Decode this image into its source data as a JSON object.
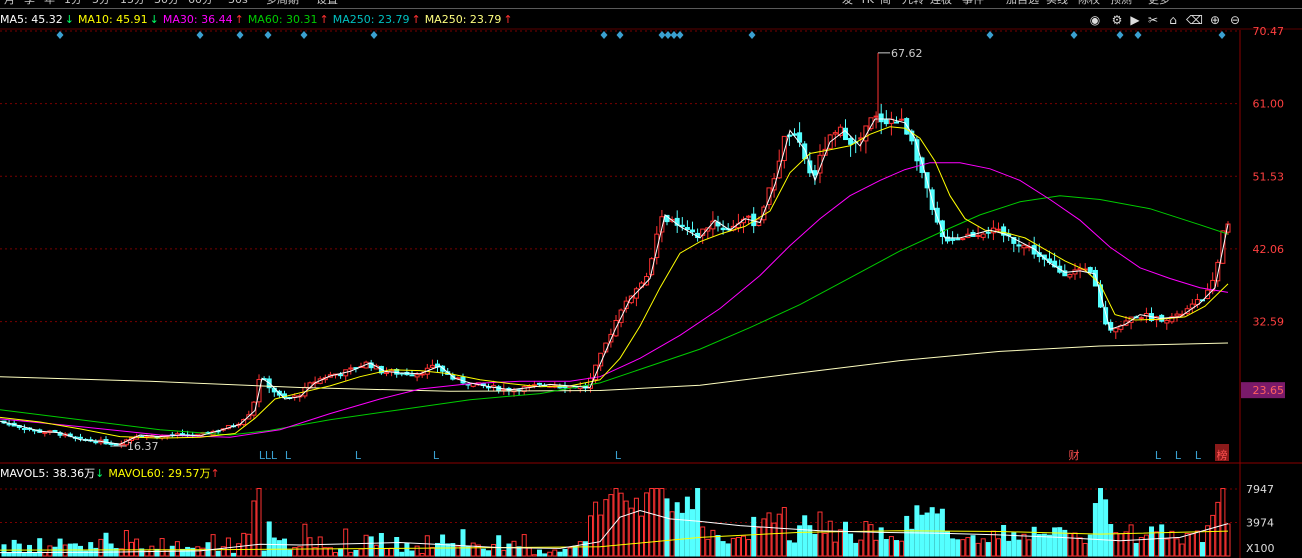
{
  "period_tabs": [
    "月",
    "季",
    "年",
    "1分",
    "5分",
    "15分",
    "30分",
    "60分",
    "30s",
    "多周期",
    "设置"
  ],
  "right_menu": [
    "发",
    "TK",
    "简",
    "九转",
    "连板",
    "事件",
    "加自选",
    "实线",
    "除权",
    "预测",
    "更多"
  ],
  "ma_legend": [
    {
      "label": "MA5: 45.32",
      "arrow": "↓",
      "color": "#ffffff"
    },
    {
      "label": "MA10: 45.91",
      "arrow": "↓",
      "color": "#ffff00"
    },
    {
      "label": "MA30: 36.44",
      "arrow": "↑",
      "color": "#ff00ff"
    },
    {
      "label": "MA60: 30.31",
      "arrow": "↑",
      "color": "#00cc00"
    },
    {
      "label": "MA250: 23.79",
      "arrow": "↑",
      "color": "#00c0c0"
    },
    {
      "label": "MA250: 23.79",
      "arrow": "↑",
      "color": "#ffff80"
    }
  ],
  "toolbar_icons": [
    "eye-icon",
    "gear-icon",
    "play-icon",
    "scissors-icon",
    "lock-icon",
    "trash-icon",
    "zoom-in-icon",
    "zoom-out-icon"
  ],
  "price_axis": [
    "70.47",
    "61.00",
    "51.53",
    "42.06",
    "32.59",
    "23.65"
  ],
  "current_price_label": "23.65",
  "high_label": "67.62",
  "low_label": "16.37",
  "volume_legend": [
    {
      "label": "MAVOL5: 38.36万",
      "arrow": "↓",
      "color": "#ffffff"
    },
    {
      "label": "MAVOL60: 29.57万",
      "arrow": "↑",
      "color": "#ffff00"
    }
  ],
  "volume_axis": [
    "7947",
    "3974"
  ],
  "volume_unit": "X100",
  "bottom_markers": [
    "L",
    "L",
    "L",
    "L",
    "L",
    "L",
    "L",
    "财",
    "L",
    "L",
    "L",
    "榜"
  ],
  "colors": {
    "up": "#ff3232",
    "down": "#54ffff",
    "ma5": "#ffffff",
    "ma10": "#ffff00",
    "ma30": "#ff00ff",
    "ma60": "#00cc00",
    "ma250": "#ffffc0",
    "grid": "#7a0000",
    "axis_text": "#ff4040",
    "marker": "#3aa0d0"
  },
  "chart_data": {
    "type": "candlestick",
    "note_price_range": [
      16.37,
      67.62
    ],
    "ylim": [
      16.37,
      70.47
    ],
    "series_names": [
      "MA5",
      "MA10",
      "MA30",
      "MA60",
      "MA250"
    ],
    "close_path": [
      [
        0,
        19.6
      ],
      [
        20,
        19.0
      ],
      [
        40,
        18.3
      ],
      [
        60,
        18.1
      ],
      [
        80,
        17.2
      ],
      [
        100,
        17.0
      ],
      [
        120,
        16.6
      ],
      [
        140,
        17.8
      ],
      [
        160,
        17.6
      ],
      [
        180,
        17.8
      ],
      [
        200,
        17.7
      ],
      [
        220,
        18.4
      ],
      [
        240,
        19.2
      ],
      [
        255,
        21.0
      ],
      [
        262,
        25.2
      ],
      [
        270,
        24.5
      ],
      [
        285,
        22.5
      ],
      [
        300,
        22.8
      ],
      [
        315,
        24.6
      ],
      [
        330,
        25.5
      ],
      [
        350,
        26.1
      ],
      [
        370,
        27.2
      ],
      [
        385,
        26.1
      ],
      [
        400,
        25.9
      ],
      [
        420,
        25.8
      ],
      [
        440,
        26.8
      ],
      [
        455,
        25.2
      ],
      [
        470,
        24.6
      ],
      [
        490,
        24.1
      ],
      [
        510,
        23.7
      ],
      [
        530,
        24.0
      ],
      [
        550,
        24.4
      ],
      [
        570,
        24.2
      ],
      [
        590,
        24.0
      ],
      [
        605,
        28.5
      ],
      [
        615,
        31.5
      ],
      [
        630,
        35.5
      ],
      [
        650,
        38.2
      ],
      [
        665,
        46.5
      ],
      [
        680,
        45.0
      ],
      [
        700,
        43.5
      ],
      [
        715,
        45.8
      ],
      [
        730,
        44.5
      ],
      [
        745,
        46.0
      ],
      [
        760,
        45.5
      ],
      [
        775,
        50.5
      ],
      [
        790,
        57.5
      ],
      [
        805,
        55.0
      ],
      [
        815,
        51.0
      ],
      [
        830,
        56.0
      ],
      [
        845,
        57.5
      ],
      [
        860,
        55.5
      ],
      [
        875,
        59.0
      ],
      [
        890,
        59.0
      ],
      [
        905,
        58.5
      ],
      [
        915,
        56.5
      ],
      [
        925,
        52.0
      ],
      [
        935,
        47.0
      ],
      [
        945,
        43.5
      ],
      [
        960,
        43.5
      ],
      [
        975,
        44.0
      ],
      [
        990,
        44.5
      ],
      [
        1005,
        44.0
      ],
      [
        1020,
        43.0
      ],
      [
        1035,
        42.0
      ],
      [
        1050,
        40.2
      ],
      [
        1065,
        39.0
      ],
      [
        1080,
        39.2
      ],
      [
        1095,
        38.8
      ],
      [
        1110,
        31.6
      ],
      [
        1125,
        32.2
      ],
      [
        1140,
        33.5
      ],
      [
        1160,
        33.0
      ],
      [
        1180,
        33.2
      ],
      [
        1200,
        35.0
      ],
      [
        1215,
        37.0
      ],
      [
        1228,
        45.3
      ]
    ],
    "ma10_path": [
      [
        0,
        20.1
      ],
      [
        40,
        19.5
      ],
      [
        80,
        18.6
      ],
      [
        120,
        17.6
      ],
      [
        160,
        17.4
      ],
      [
        200,
        17.5
      ],
      [
        235,
        18.0
      ],
      [
        255,
        20.0
      ],
      [
        275,
        22.5
      ],
      [
        300,
        23.3
      ],
      [
        330,
        24.2
      ],
      [
        360,
        25.4
      ],
      [
        390,
        26.3
      ],
      [
        420,
        26.2
      ],
      [
        450,
        25.8
      ],
      [
        480,
        25.0
      ],
      [
        510,
        24.5
      ],
      [
        540,
        24.1
      ],
      [
        570,
        24.2
      ],
      [
        600,
        25.0
      ],
      [
        620,
        27.8
      ],
      [
        640,
        32.0
      ],
      [
        660,
        37.0
      ],
      [
        680,
        41.5
      ],
      [
        700,
        43.0
      ],
      [
        720,
        44.0
      ],
      [
        745,
        45.0
      ],
      [
        770,
        47.0
      ],
      [
        790,
        52.0
      ],
      [
        810,
        54.5
      ],
      [
        830,
        55.0
      ],
      [
        850,
        55.5
      ],
      [
        870,
        57.0
      ],
      [
        890,
        58.0
      ],
      [
        905,
        57.8
      ],
      [
        920,
        56.5
      ],
      [
        935,
        53.5
      ],
      [
        950,
        49.0
      ],
      [
        965,
        46.0
      ],
      [
        985,
        44.5
      ],
      [
        1005,
        44.2
      ],
      [
        1025,
        43.5
      ],
      [
        1045,
        42.0
      ],
      [
        1065,
        40.5
      ],
      [
        1085,
        39.3
      ],
      [
        1100,
        37.5
      ],
      [
        1115,
        33.5
      ],
      [
        1135,
        32.8
      ],
      [
        1160,
        32.9
      ],
      [
        1185,
        33.2
      ],
      [
        1205,
        34.6
      ],
      [
        1228,
        37.5
      ]
    ],
    "ma30_path": [
      [
        0,
        19.9
      ],
      [
        80,
        18.9
      ],
      [
        160,
        17.8
      ],
      [
        230,
        17.5
      ],
      [
        280,
        18.5
      ],
      [
        330,
        20.6
      ],
      [
        380,
        22.5
      ],
      [
        420,
        23.8
      ],
      [
        470,
        24.5
      ],
      [
        520,
        24.8
      ],
      [
        570,
        24.8
      ],
      [
        600,
        25.4
      ],
      [
        640,
        27.8
      ],
      [
        680,
        30.8
      ],
      [
        720,
        34.3
      ],
      [
        760,
        38.6
      ],
      [
        790,
        42.5
      ],
      [
        820,
        46.0
      ],
      [
        850,
        49.0
      ],
      [
        880,
        51.0
      ],
      [
        905,
        52.4
      ],
      [
        930,
        53.3
      ],
      [
        960,
        53.3
      ],
      [
        990,
        52.5
      ],
      [
        1020,
        51.0
      ],
      [
        1050,
        48.5
      ],
      [
        1080,
        45.8
      ],
      [
        1110,
        42.3
      ],
      [
        1140,
        39.6
      ],
      [
        1170,
        38.2
      ],
      [
        1200,
        37.0
      ],
      [
        1228,
        36.4
      ]
    ],
    "ma60_path": [
      [
        0,
        21.1
      ],
      [
        80,
        19.8
      ],
      [
        160,
        18.5
      ],
      [
        230,
        17.8
      ],
      [
        270,
        18.4
      ],
      [
        330,
        19.8
      ],
      [
        400,
        21.1
      ],
      [
        470,
        22.4
      ],
      [
        540,
        23.2
      ],
      [
        600,
        24.6
      ],
      [
        650,
        26.8
      ],
      [
        700,
        29.0
      ],
      [
        750,
        31.8
      ],
      [
        800,
        34.8
      ],
      [
        850,
        38.3
      ],
      [
        900,
        41.8
      ],
      [
        940,
        44.2
      ],
      [
        980,
        46.5
      ],
      [
        1020,
        48.2
      ],
      [
        1060,
        49.0
      ],
      [
        1100,
        48.5
      ],
      [
        1150,
        47.3
      ],
      [
        1200,
        45.2
      ],
      [
        1228,
        44.0
      ]
    ],
    "ma250_path": [
      [
        0,
        25.4
      ],
      [
        150,
        24.8
      ],
      [
        300,
        24.0
      ],
      [
        450,
        23.5
      ],
      [
        600,
        23.6
      ],
      [
        700,
        24.3
      ],
      [
        800,
        25.9
      ],
      [
        900,
        27.5
      ],
      [
        1000,
        28.7
      ],
      [
        1100,
        29.4
      ],
      [
        1228,
        29.8
      ]
    ],
    "volume_mavol5_path": [
      [
        0,
        400
      ],
      [
        100,
        450
      ],
      [
        200,
        600
      ],
      [
        260,
        1400
      ],
      [
        300,
        1300
      ],
      [
        400,
        1600
      ],
      [
        450,
        1300
      ],
      [
        500,
        1000
      ],
      [
        560,
        900
      ],
      [
        600,
        1700
      ],
      [
        620,
        4600
      ],
      [
        640,
        5400
      ],
      [
        670,
        4400
      ],
      [
        700,
        4100
      ],
      [
        740,
        3600
      ],
      [
        780,
        3300
      ],
      [
        820,
        3000
      ],
      [
        880,
        2800
      ],
      [
        940,
        2700
      ],
      [
        1000,
        2500
      ],
      [
        1060,
        2200
      ],
      [
        1120,
        1800
      ],
      [
        1180,
        2200
      ],
      [
        1228,
        3836
      ]
    ],
    "volume_mavol60_path": [
      [
        0,
        700
      ],
      [
        200,
        750
      ],
      [
        400,
        900
      ],
      [
        600,
        1100
      ],
      [
        700,
        2200
      ],
      [
        800,
        2800
      ],
      [
        900,
        3000
      ],
      [
        1000,
        2900
      ],
      [
        1100,
        2600
      ],
      [
        1228,
        2957
      ]
    ]
  }
}
